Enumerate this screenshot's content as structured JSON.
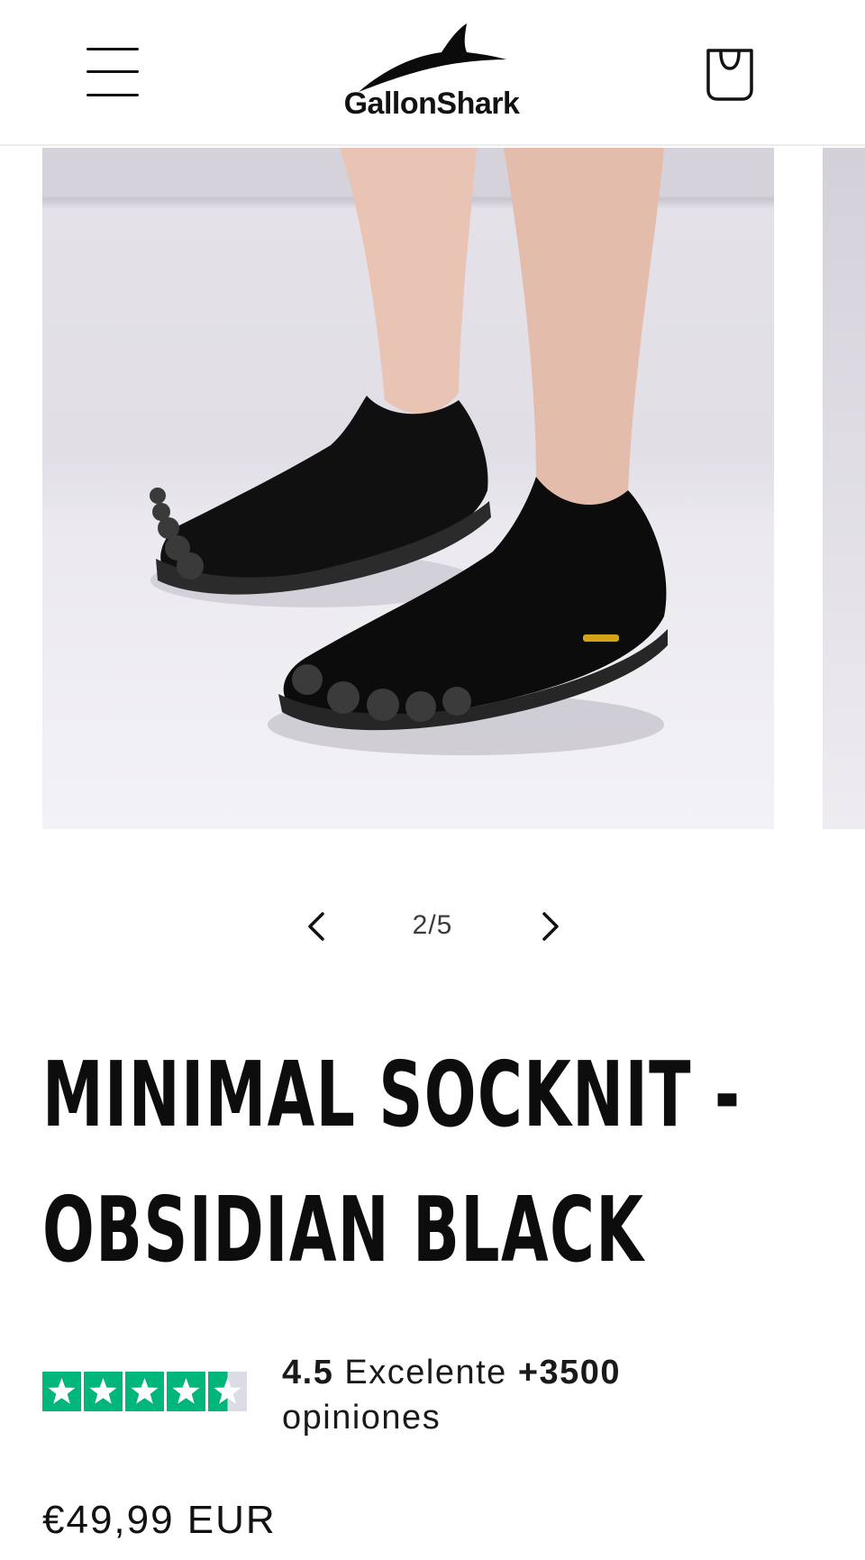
{
  "header": {
    "menu_icon": "hamburger-menu-icon",
    "brand": "GallonShark",
    "cart_icon": "shopping-bag-icon"
  },
  "gallery": {
    "image_alt": "Minimal Socknit barefoot toe shoes in black worn on feet",
    "counter": "2/5",
    "prev_icon": "chevron-left-icon",
    "next_icon": "chevron-right-icon"
  },
  "product": {
    "title": "MINIMAL SOCKNIT - OBSIDIAN BLACK",
    "price": "€49,99 EUR"
  },
  "rating": {
    "score": "4.5",
    "label": "Excelente",
    "count": "+3500",
    "count_suffix": "opiniones",
    "stars_value": 4.5,
    "stars_max": 5,
    "star_color": "#00b67a",
    "star_empty_color": "#dcdce6"
  }
}
